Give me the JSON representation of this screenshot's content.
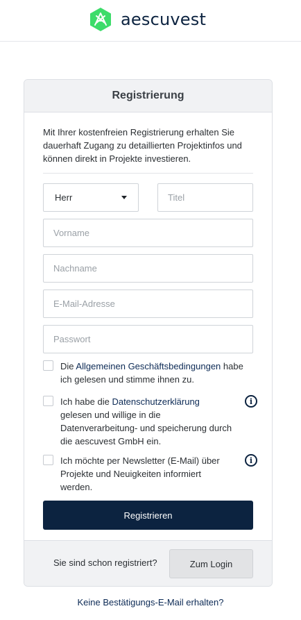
{
  "brand": {
    "name": "aescuvest",
    "logo_color": "#3ddc6a"
  },
  "card": {
    "title": "Registrierung",
    "intro": "Mit Ihrer kostenfreien Registrierung erhalten Sie dauerhaft Zugang zu detaillierten Projektinfos und können direkt in Projekte investieren."
  },
  "form": {
    "salutation": {
      "value": "Herr"
    },
    "title_field": {
      "placeholder": "Titel"
    },
    "firstname": {
      "placeholder": "Vorname"
    },
    "lastname": {
      "placeholder": "Nachname"
    },
    "email": {
      "placeholder": "E-Mail-Adresse"
    },
    "password": {
      "placeholder": "Passwort"
    }
  },
  "consents": {
    "agb": {
      "pre": "Die ",
      "link": "Allgemeinen Geschäftsbedingungen",
      "post": " habe ich gelesen und stimme ihnen zu."
    },
    "privacy": {
      "pre": "Ich habe die ",
      "link": "Datenschutzerklärung",
      "post": " gelesen und willige in die Datenverarbeitung- und speicherung durch die aescuvest GmbH ein.",
      "info_icon": "info-icon"
    },
    "newsletter": {
      "text": "Ich möchte per Newsletter (E-Mail) über Projekte und Neuigkeiten informiert werden.",
      "info_icon": "info-icon"
    }
  },
  "actions": {
    "register_label": "Registrieren",
    "primary_color": "#0c2340"
  },
  "footer": {
    "already_registered": "Sie sind schon registriert?",
    "login_label": "Zum Login"
  },
  "links": {
    "no_confirmation": "Keine Bestätigungs-E-Mail erhalten?"
  }
}
